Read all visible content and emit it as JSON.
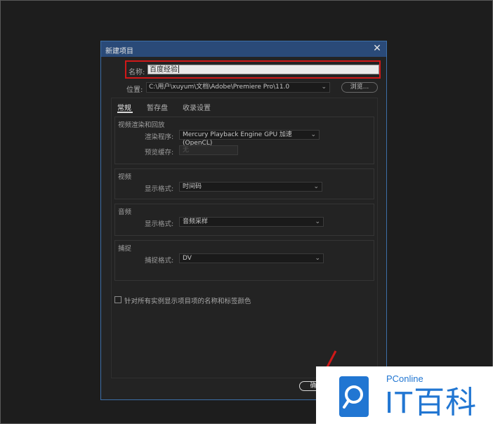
{
  "dialog": {
    "title": "新建项目",
    "close_icon": "close-icon",
    "name_label": "名称:",
    "name_value": "百度经验",
    "location_label": "位置:",
    "location_value": "C:\\用户\\xuyum\\文档\\Adobe\\Premiere Pro\\11.0",
    "browse_label": "浏览...",
    "tabs": [
      {
        "label": "常规",
        "active": true
      },
      {
        "label": "暂存盘",
        "active": false
      },
      {
        "label": "收录设置",
        "active": false
      }
    ],
    "groups": {
      "video_render": {
        "title": "视频渲染和回放",
        "renderer_label": "渲染程序:",
        "renderer_value": "Mercury Playback Engine GPU 加速 (OpenCL)",
        "preview_cache_label": "预览缓存:",
        "preview_cache_value": "无"
      },
      "video": {
        "title": "视频",
        "display_format_label": "显示格式:",
        "display_format_value": "时间码"
      },
      "audio": {
        "title": "音频",
        "display_format_label": "显示格式:",
        "display_format_value": "音频采样"
      },
      "capture": {
        "title": "捕捉",
        "capture_format_label": "捕捉格式:",
        "capture_format_value": "DV"
      }
    },
    "checkbox_label": "针对所有实例显示项目项的名称和标签颜色",
    "checkbox_checked": false,
    "ok_label": "确"
  },
  "watermark": {
    "brand": "PConline",
    "name": "IT百科",
    "color": "#2176d2"
  },
  "colors": {
    "annotation": "#d01818",
    "titlebar": "#2a4a78"
  }
}
